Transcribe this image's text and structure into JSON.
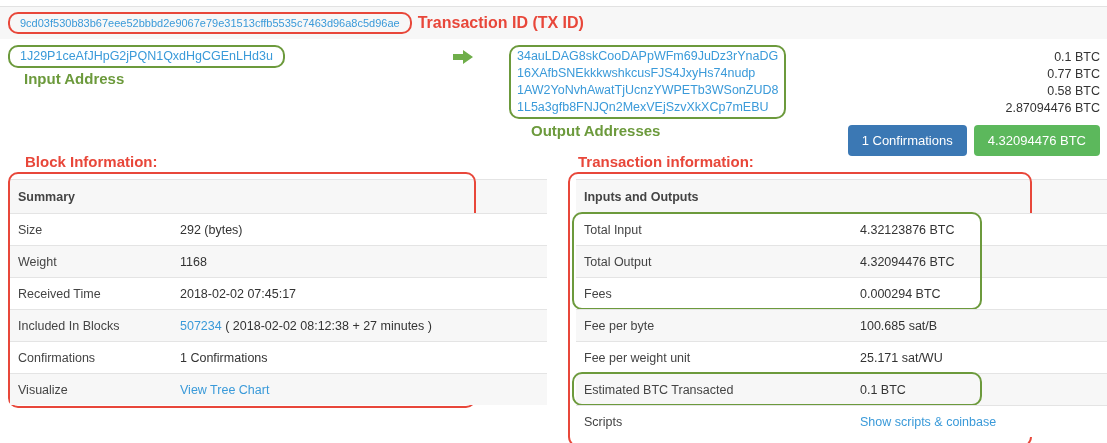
{
  "transaction_id": {
    "value": "9cd03f530b83b67eee52bbbd2e9067e79e31513cffb5535c7463d96a8c5d96ae",
    "annotation": "Transaction ID (TX ID)"
  },
  "input": {
    "address": "1J29P1ceAfJHpG2jPQN1QxdHgCGEnLHd3u",
    "annotation": "Input Address"
  },
  "outputs": {
    "annotation": "Output Addresses",
    "items": [
      {
        "address": "34auLDAG8skCooDAPpWFm69JuDz3rYnaDG",
        "amount": "0.1 BTC"
      },
      {
        "address": "16XAfbSNEkkkwshkcusFJS4JxyHs74nudp",
        "amount": "0.77 BTC"
      },
      {
        "address": "1AW2YoNvhAwatTjUcnzYWPETb3WSonZUD8",
        "amount": "0.58 BTC"
      },
      {
        "address": "1L5a3gfb8FNJQn2MexVEjSzvXkXCp7mEBU",
        "amount": "2.87094476 BTC"
      }
    ]
  },
  "badges": [
    {
      "label": "1 Confirmations",
      "kind": "info"
    },
    {
      "label": "4.32094476 BTC",
      "kind": "success"
    }
  ],
  "block_information": {
    "annotation": "Block Information:",
    "header": "Summary",
    "sections": [
      {
        "highlighted": false,
        "rows": [
          {
            "label": "Size",
            "value": "292 (bytes)"
          },
          {
            "label": "Weight",
            "value": "1168"
          },
          {
            "label": "Received Time",
            "value": "2018-02-02 07:45:17"
          },
          {
            "label": "Included In Blocks",
            "link": "507234",
            "value": "( 2018-02-02 08:12:38 + 27 minutes )"
          },
          {
            "label": "Confirmations",
            "value": "1 Confirmations"
          },
          {
            "label": "Visualize",
            "link": "View Tree Chart"
          }
        ]
      }
    ]
  },
  "transaction_information": {
    "annotation": "Transaction information:",
    "header": "Inputs and Outputs",
    "sections": [
      {
        "highlighted": true,
        "rows": [
          {
            "label": "Total Input",
            "value": "4.32123876 BTC"
          },
          {
            "label": "Total Output",
            "value": "4.32094476 BTC"
          },
          {
            "label": "Fees",
            "value": "0.000294 BTC"
          }
        ]
      },
      {
        "highlighted": false,
        "rows": [
          {
            "label": "Fee per byte",
            "value": "100.685 sat/B"
          },
          {
            "label": "Fee per weight unit",
            "value": "25.171 sat/WU"
          }
        ]
      },
      {
        "highlighted": true,
        "rows": [
          {
            "label": "Estimated BTC Transacted",
            "value": "0.1 BTC"
          }
        ]
      },
      {
        "highlighted": false,
        "rows": [
          {
            "label": "Scripts",
            "link": "Show scripts & coinbase"
          }
        ]
      }
    ]
  }
}
